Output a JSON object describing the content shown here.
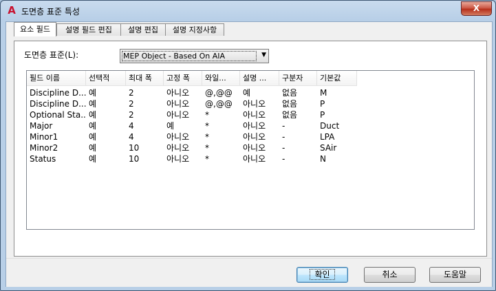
{
  "window": {
    "title": "도면층 표준 특성",
    "close_label": "X"
  },
  "tabs": [
    {
      "label": "요소 필드"
    },
    {
      "label": "설명 필드 편집"
    },
    {
      "label": "설명 편집"
    },
    {
      "label": "설명 지정사항"
    }
  ],
  "standard": {
    "label": "도면층 표준(L):",
    "value": "MEP Object - Based On AIA"
  },
  "table": {
    "headers": [
      "필드 이름",
      "선택적",
      "최대 폭",
      "고정 폭",
      "와일...",
      "설명 ...",
      "구분자",
      "기본값"
    ],
    "rows": [
      [
        "Discipline D...",
        "예",
        "2",
        "아니오",
        "@,@@",
        "예",
        "없음",
        "M"
      ],
      [
        "Discipline D...",
        "예",
        "2",
        "아니오",
        "@,@@",
        "아니오",
        "없음",
        "P"
      ],
      [
        "Optional Sta...",
        "예",
        "2",
        "아니오",
        "*",
        "아니오",
        "없음",
        "P"
      ],
      [
        "Major",
        "예",
        "4",
        "예",
        "*",
        "아니오",
        "-",
        "Duct"
      ],
      [
        "Minor1",
        "예",
        "4",
        "아니오",
        "*",
        "아니오",
        "-",
        "LPA"
      ],
      [
        "Minor2",
        "예",
        "10",
        "아니오",
        "*",
        "아니오",
        "-",
        "SAir"
      ],
      [
        "Status",
        "예",
        "10",
        "아니오",
        "*",
        "아니오",
        "-",
        "N"
      ]
    ]
  },
  "toolbar_icons": [
    "delete-icon",
    "move-up-icon",
    "move-down-icon"
  ],
  "buttons": {
    "ok": "확인",
    "cancel": "취소",
    "help": "도움말"
  },
  "colors": {
    "titlebar": "#b8cfe7",
    "close_button": "#c9513e",
    "delete_red": "#d01010",
    "default_button": "#bee6fd"
  }
}
